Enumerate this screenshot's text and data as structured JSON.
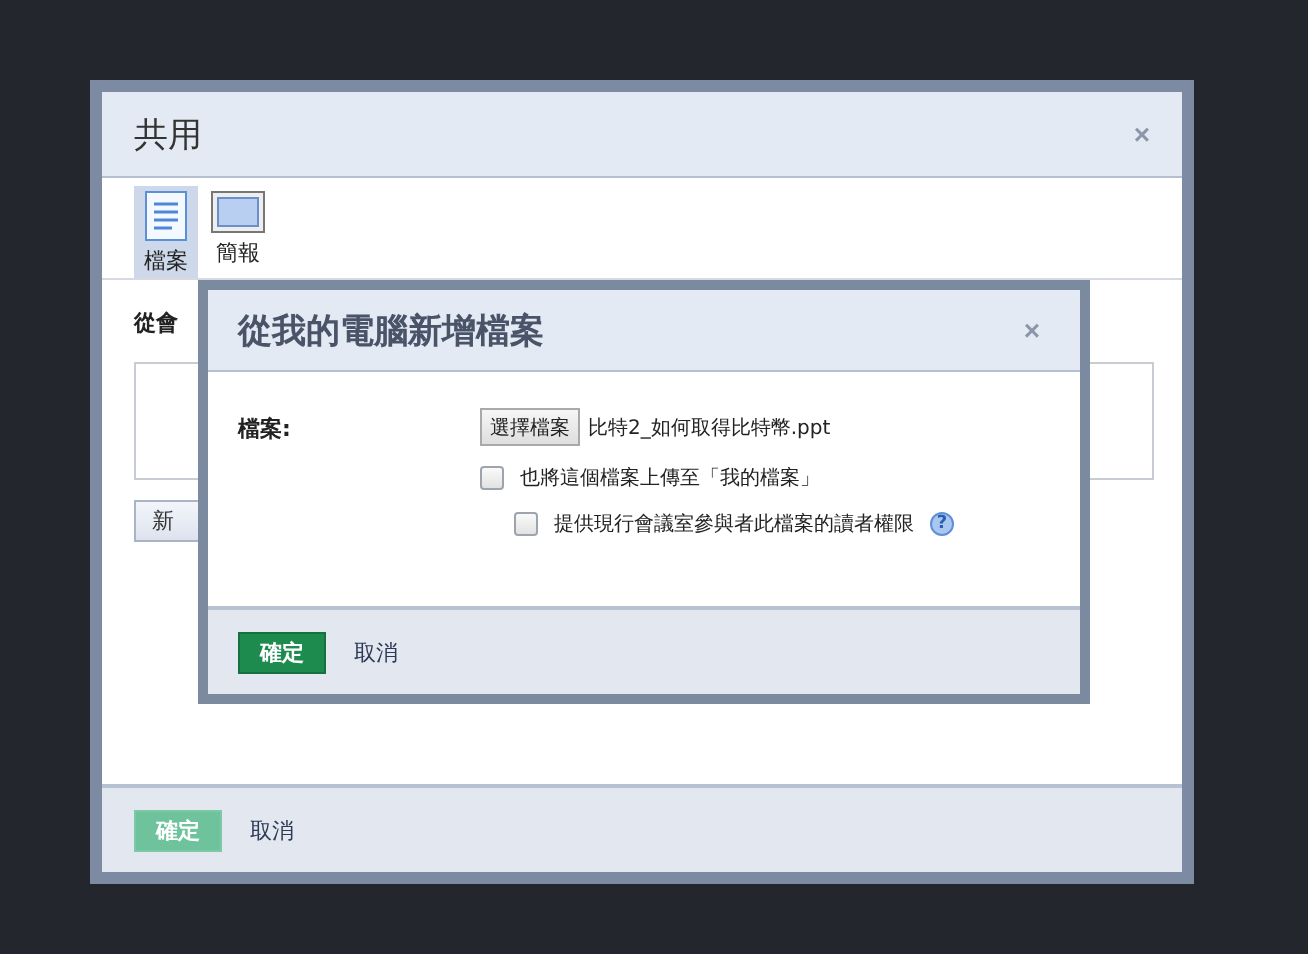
{
  "dialog": {
    "title": "共用",
    "close": "×"
  },
  "tabs": [
    {
      "label": "檔案",
      "kind": "document",
      "selected": true
    },
    {
      "label": "簡報",
      "kind": "slide",
      "selected": false
    }
  ],
  "body": {
    "section_label": "從會",
    "add_button": "新"
  },
  "footer": {
    "ok": "確定",
    "cancel": "取消"
  },
  "upload_dialog": {
    "title": "從我的電腦新增檔案",
    "close": "×",
    "file_label": "檔案:",
    "choose_button": "選擇檔案",
    "file_name": "比特2_如何取得比特幣.ppt",
    "options": [
      {
        "label": "也將這個檔案上傳至「我的檔案」",
        "checked": false,
        "children": [
          {
            "label": "提供現行會議室參與者此檔案的讀者權限",
            "checked": false,
            "help_text": "?"
          }
        ]
      }
    ],
    "ok": "確定",
    "cancel": "取消"
  }
}
